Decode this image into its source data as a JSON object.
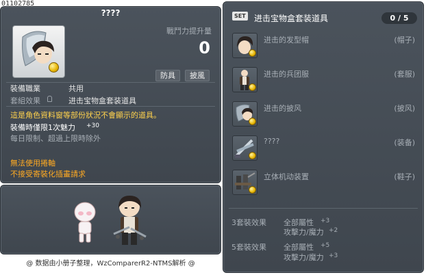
{
  "watermark_id": "01102785",
  "left_panel": {
    "item_title": "????",
    "power_label": "戰鬥力提升量",
    "power_value": "0",
    "tags": [
      "防具",
      "披風"
    ],
    "job_label": "裝備職業",
    "job_value": "共用",
    "set_label": "套組效果",
    "set_value": "进击宝物盒套装道具",
    "warning_line": "這是角色資料窗等部份狀況不會顯示的道具。",
    "charm_label": "裝備時僅限1次魅力",
    "charm_value": "+30",
    "limit_line": "每日限制、超過上限時除外",
    "no_scroll_line": "無法使用捲軸",
    "no_transfer_line": "不接受寄裝化插畫請求"
  },
  "credit": "@ 数据由小册子整理，WzComparerR2-NTMS解析 @",
  "set_panel": {
    "badge": "SET",
    "title": "进击宝物盒套装道具",
    "count": "0 / 5",
    "items": [
      {
        "name": "进击的发型帽",
        "type": "(帽子)",
        "icon": "hair-hat-icon"
      },
      {
        "name": "进击的兵团服",
        "type": "(套服)",
        "icon": "uniform-icon"
      },
      {
        "name": "进击的披风",
        "type": "(披风)",
        "icon": "cape-icon"
      },
      {
        "name": "????",
        "type": "(装备)",
        "icon": "blades-icon"
      },
      {
        "name": "立体机动装置",
        "type": "(鞋子)",
        "icon": "maneuver-gear-icon"
      }
    ],
    "effects": [
      {
        "label": "3套裝效果",
        "lines": [
          {
            "stat": "全部屬性",
            "value": "+3"
          },
          {
            "stat": "攻擊力/魔力",
            "value": "+2"
          }
        ]
      },
      {
        "label": "5套裝效果",
        "lines": [
          {
            "stat": "全部屬性",
            "value": "+5"
          },
          {
            "stat": "攻擊力/魔力",
            "value": "+3"
          }
        ]
      }
    ]
  }
}
